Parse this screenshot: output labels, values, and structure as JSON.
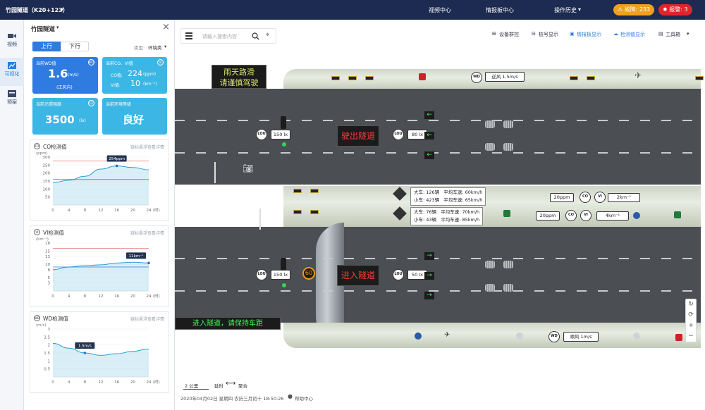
{
  "header": {
    "title": "竹园隧道（K20+123）",
    "chevron": "▾",
    "menu_video": "视频中心",
    "menu_board": "情报板中心",
    "menu_history": "操作历史",
    "menu_history_chevron": "▾",
    "fault_label": "故障: 233",
    "alarm_label": "报警: 3"
  },
  "nav": {
    "items": [
      {
        "label": "视频",
        "icon": "video-icon"
      },
      {
        "label": "可视化",
        "icon": "chart-icon"
      },
      {
        "label": "预案",
        "icon": "plan-icon"
      }
    ]
  },
  "sidebar": {
    "title": "竹园隧道",
    "chevron": "▾",
    "close": "×",
    "tabs": [
      "上行",
      "下行"
    ],
    "type_label": "类型:",
    "type_value": "环境类",
    "cards": {
      "wd_title": "当前WD值",
      "wd_value": "1.6",
      "wd_unit": "(m/s)",
      "wd_sub": "(正风向)",
      "covi_title": "当前CO、VI值",
      "co_label": "CO值:",
      "co_value": "224",
      "co_unit": "(ppm)",
      "vi_label": "VI值:",
      "vi_value": "10",
      "vi_unit": "(km⁻¹)",
      "light_title": "当前光照强度",
      "light_value": "3500",
      "light_unit": "(lx)",
      "env_title": "当前环境等级",
      "env_value": "良好"
    },
    "link": "链标悬浮查看详情"
  },
  "chart_data": [
    {
      "type": "line",
      "title": "CO检测值",
      "ylabel": "(ppm)",
      "xlabel": "(时)",
      "x": [
        0,
        4,
        8,
        12,
        16,
        20,
        24
      ],
      "y": [
        140,
        155,
        180,
        225,
        245,
        235,
        220
      ],
      "threshold": 275,
      "reference": 160,
      "ylim": [
        0,
        300
      ],
      "yticks": [
        50,
        100,
        150,
        200,
        250,
        300
      ],
      "annotation": "254ppm"
    },
    {
      "type": "line",
      "title": "VI检测值",
      "ylabel": "(km⁻¹)",
      "xlabel": "(时)",
      "x": [
        0,
        4,
        8,
        12,
        16,
        20,
        24
      ],
      "y": [
        8,
        9,
        9.5,
        9.8,
        10.5,
        10.8,
        10.5
      ],
      "threshold": 16,
      "reference": 9,
      "ylim": [
        0,
        18
      ],
      "yticks": [
        3,
        5,
        8,
        10,
        13,
        15,
        18
      ],
      "annotation": "11km⁻¹"
    },
    {
      "type": "line",
      "title": "WD检测值",
      "ylabel": "(m/s)",
      "xlabel": "(时)",
      "x": [
        0,
        4,
        8,
        12,
        16,
        20,
        24
      ],
      "y": [
        2.1,
        1.8,
        1.5,
        1.35,
        1.45,
        1.6,
        1.75
      ],
      "ylim": [
        0,
        3.0
      ],
      "yticks": [
        0.5,
        1.0,
        1.5,
        2.0,
        2.5,
        3.0
      ],
      "annotation": "1.5m/s"
    }
  ],
  "toolbar": {
    "search_placeholder": "请输入搜索内容",
    "device_group": "设备群控",
    "pile_show": "桩号显示",
    "board_show": "情报板显示",
    "detect_show": "检测值显示",
    "toolbox": "工具箱"
  },
  "tunnel": {
    "vms_top_line1": "雨天路滑",
    "vms_top_line2": "请谨慎驾驶",
    "vms_exit": "驶出隧道",
    "vms_enter": "进入隧道",
    "vms_bottom": "进入隧道，请保持车距",
    "lux_top1": "150 lx",
    "lux_top2": "80 lx",
    "lux_bot1": "150 lx",
    "lux_bot2": "50 lx",
    "lou": "LOU",
    "wd": "WD",
    "co": "CO",
    "vi": "VI",
    "wd_top": "逆风  1.5m/s",
    "wd_bot": "顺风  1m/s",
    "co_mid1": "20ppm",
    "vi_mid1": "2km⁻¹",
    "co_mid2": "20ppm",
    "vi_mid2": "4km⁻¹",
    "speed_limit": "60",
    "info1": {
      "big": "大车: 126辆",
      "small": "小车: 423辆",
      "big_speed": "平均车速: 60km/h",
      "small_speed": "平均车速: 65km/h"
    },
    "info2": {
      "big": "大车: 76辆",
      "small": "小车: 43辆",
      "big_speed": "平均车速: 70km/h",
      "small_speed": "平均车速: 85km/h"
    }
  },
  "footer": {
    "scale": "2 公里",
    "legend_a": "延时",
    "legend_arrow": "⟷",
    "legend_b": "聚合",
    "datetime": "2020年04月02日  星期四  农历三月初十  18:50:26",
    "help": "帮助中心"
  },
  "colors": {
    "nav_bg": "#1d2b52",
    "card_blue": "#2f7be0",
    "card_cyan": "#3cb6e4",
    "fault": "#f0a020",
    "alarm": "#e0242c",
    "accent": "#2f7be0"
  }
}
